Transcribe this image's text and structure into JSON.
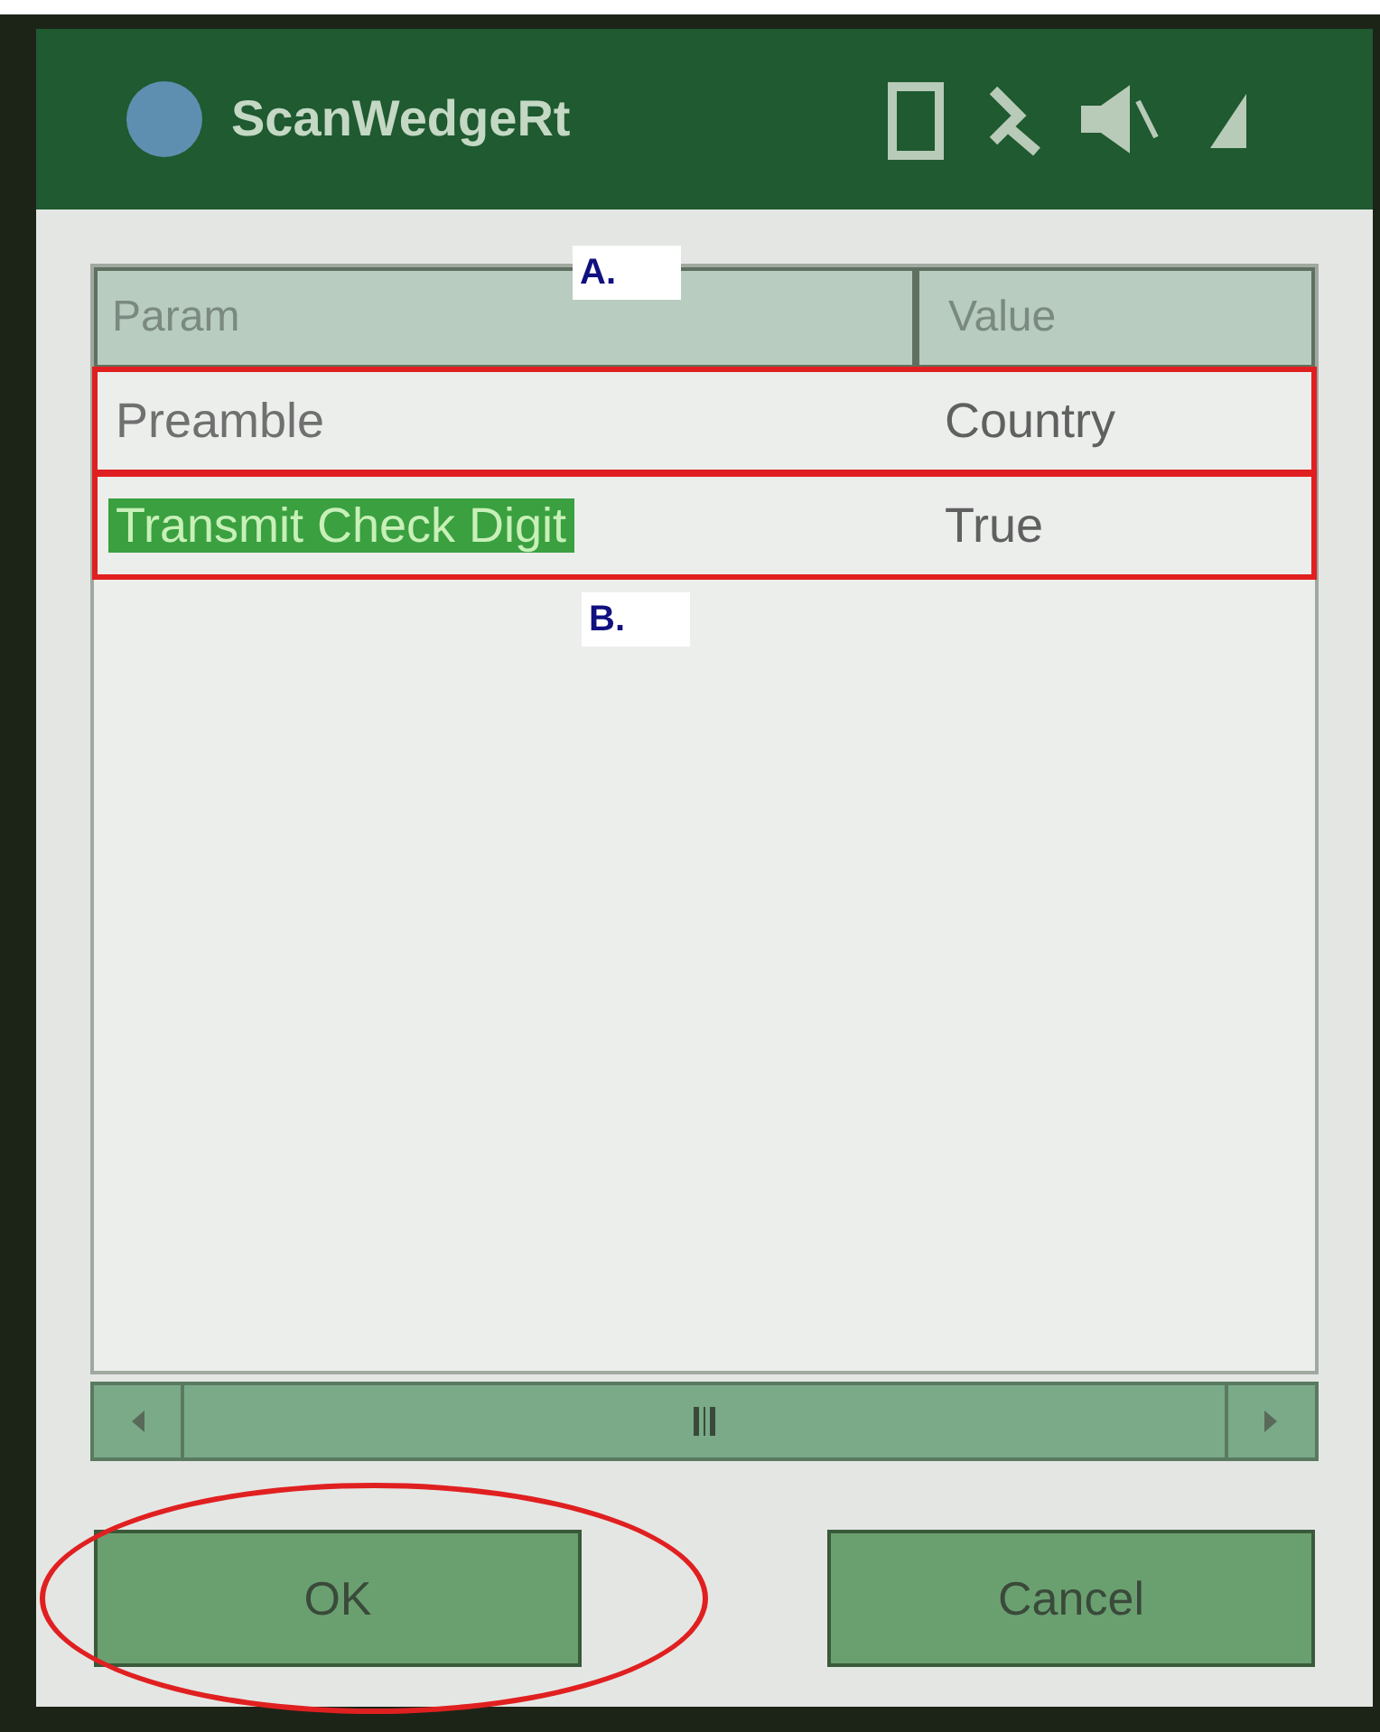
{
  "window": {
    "title": "ScanWedgeRt"
  },
  "table": {
    "columns": [
      "Param",
      "Value"
    ],
    "rows": [
      {
        "param": "Preamble",
        "value": "Country",
        "selected": false,
        "annotated": true
      },
      {
        "param": "Transmit Check Digit",
        "value": "True",
        "selected": true,
        "annotated": true
      }
    ]
  },
  "annotations": [
    "A.",
    "B."
  ],
  "buttons": [
    {
      "label": "OK",
      "circled": true
    },
    {
      "label": "Cancel",
      "circled": false
    }
  ]
}
